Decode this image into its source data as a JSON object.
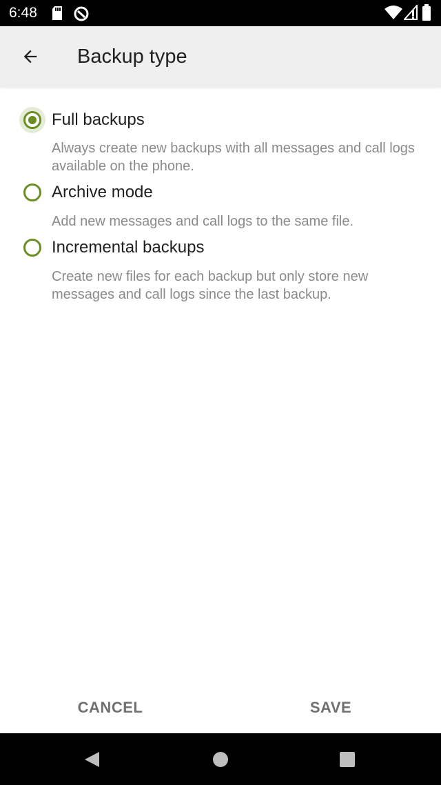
{
  "status_bar": {
    "time": "6:48",
    "icons": [
      "sd-card-icon",
      "data-saver-icon",
      "wifi-icon",
      "signal-icon",
      "battery-icon"
    ]
  },
  "app_bar": {
    "back_icon": "arrow-left-icon",
    "title": "Backup type"
  },
  "options": [
    {
      "label": "Full backups",
      "description": "Always create new backups with all messages and call logs available on the phone.",
      "selected": true
    },
    {
      "label": "Archive mode",
      "description": "Add new messages and call logs to the same file.",
      "selected": false
    },
    {
      "label": "Incremental backups",
      "description": "Create new files for each backup but only store new messages and call logs since the last backup.",
      "selected": false
    }
  ],
  "footer": {
    "cancel_label": "CANCEL",
    "save_label": "SAVE"
  },
  "nav_bar": {
    "icons": [
      "back-triangle-icon",
      "home-circle-icon",
      "recents-square-icon"
    ]
  },
  "colors": {
    "accent": "#6b8e23",
    "app_bar_bg": "#efefef",
    "description_text": "#8a8a8a",
    "button_text": "#707070"
  }
}
